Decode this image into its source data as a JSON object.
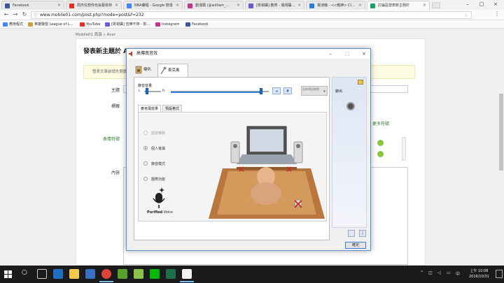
{
  "browser": {
    "tabs": [
      {
        "label": "Facebook",
        "color": "#3b5998"
      },
      {
        "label": "周杰伦想你也会蔡依林",
        "color": "#e52d27"
      },
      {
        "label": "NBA賽程 - Google 搜尋",
        "color": "#4285f4"
      },
      {
        "label": "劉濱楓 (@william_...",
        "color": "#c13584"
      },
      {
        "label": "[衛視攝] 教育 - 電視攝...",
        "color": "#6b5bd2"
      },
      {
        "label": "電池機 - <<戰神> Cl...",
        "color": "#2a7bd6"
      },
      {
        "label": "討論區發表新主題於",
        "color": "#1aa260"
      }
    ],
    "url": "www.mobile01.com/post.php?mode=post&f=232",
    "bookmarks": [
      {
        "label": "應用程式",
        "color": "#4285f4"
      },
      {
        "label": "英雄聯盟 League of L...",
        "color": "#c9a23a"
      },
      {
        "label": "YouTube",
        "color": "#e52d27"
      },
      {
        "label": "[衛視攝] 音樂不停 - 影...",
        "color": "#6b5bd2"
      },
      {
        "label": "Instagram",
        "color": "#c13584"
      },
      {
        "label": "Facebook",
        "color": "#3b5998"
      }
    ]
  },
  "page": {
    "breadcrumb": "Mobile01 首頁 » Acer",
    "title": "發表新主題於 Acer",
    "notice": "發表文章前請先閱讀...",
    "labels": {
      "subject": "主題",
      "tags": "標籤",
      "emoji": "表情符號",
      "content": "內容",
      "more_emoji": "更多符號"
    }
  },
  "dialog": {
    "title": "高傳真音效",
    "tabs": {
      "speakers": "喇叭",
      "microphone": "麥克風"
    },
    "volume_label": "錄音音量",
    "left": "L",
    "right": "R",
    "volume_level": 0.92,
    "balance_level": 0.1,
    "combo_text": "設為預設裝置",
    "subtabs": {
      "effects": "麥克風效果",
      "format": "預設格式"
    },
    "options": [
      {
        "label": "語音移除",
        "checked": false,
        "disabled": true
      },
      {
        "label": "個人會議",
        "checked": true,
        "disabled": false
      },
      {
        "label": "錄音模式",
        "checked": false,
        "disabled": false
      },
      {
        "label": "團際功能",
        "checked": false,
        "disabled": false
      }
    ],
    "logo_text": "Purified",
    "logo_suffix": ".Voice",
    "right_panel_label": "錄出",
    "ok": "確定"
  },
  "taskbar": {
    "time": "上午 10:08",
    "date": "2016/10/31"
  },
  "colors": {
    "accent": "#1e74d8",
    "taskbar": "#1b1b1d"
  }
}
